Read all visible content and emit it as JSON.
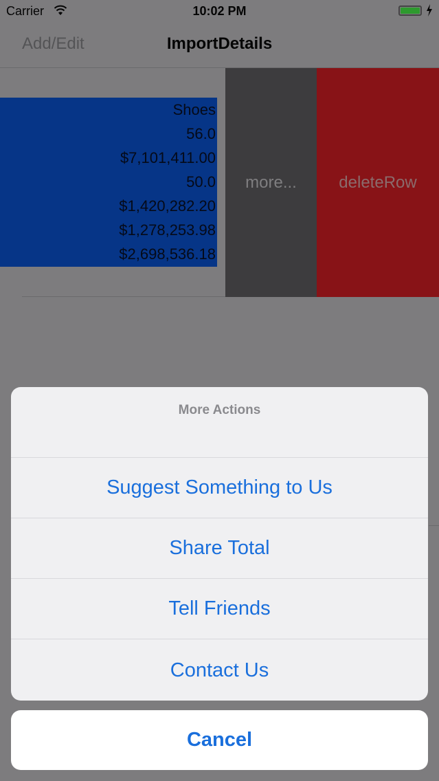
{
  "status_bar": {
    "carrier": "Carrier",
    "time": "10:02 PM",
    "icons": [
      "wifi-icon",
      "battery-icon",
      "charging-bolt-icon"
    ],
    "battery_color": "#2e9a2e"
  },
  "nav": {
    "left_button": "Add/Edit",
    "title": "ImportDetails"
  },
  "row": {
    "lines": [
      "Shoes",
      "56.0",
      "$7,101,411.00",
      "50.0",
      "$1,420,282.20",
      "$1,278,253.98",
      "$2,698,536.18"
    ],
    "background_color": "#063587"
  },
  "swipe_actions": {
    "more": "more...",
    "delete": "deleteRow",
    "more_color": "#3d3c3e",
    "delete_color": "#881317"
  },
  "action_sheet": {
    "title": "More Actions",
    "actions": [
      "Suggest Something to Us",
      "Share Total",
      "Tell Friends",
      "Contact Us"
    ],
    "cancel": "Cancel",
    "accent_color": "#1a6fdc"
  }
}
